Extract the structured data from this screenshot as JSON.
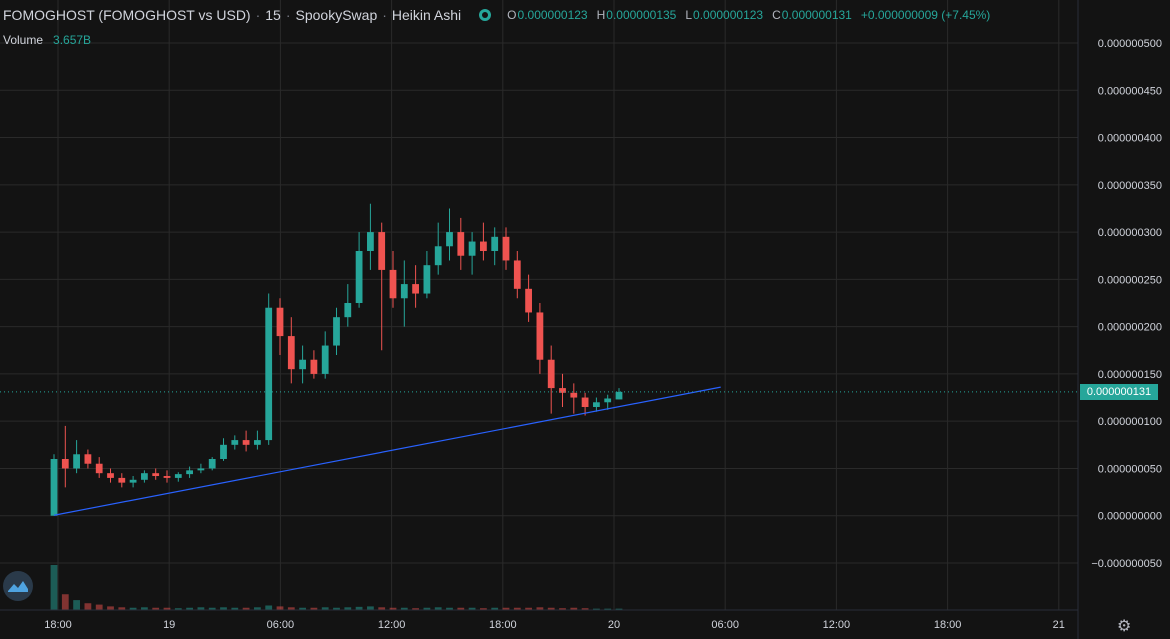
{
  "header": {
    "symbol": "FOMOGHOST (FOMOGHOST vs USD)",
    "interval": "15",
    "exchange": "SpookySwap",
    "chart_style": "Heikin Ashi",
    "ohlc": {
      "o_label": "O",
      "o": "0.000000123",
      "h_label": "H",
      "h": "0.000000135",
      "l_label": "L",
      "l": "0.000000123",
      "c_label": "C",
      "c": "0.000000131",
      "change": "+0.000000009 (+7.45%)"
    }
  },
  "volume": {
    "label": "Volume",
    "value": "3.657B"
  },
  "current_price_label": "0.000000131",
  "colors": {
    "up": "#26a69a",
    "down": "#ef5350",
    "trendline": "#2962ff",
    "grid": "#2a2a2a",
    "text": "#d1d4dc"
  },
  "icons": {
    "settings": "gear-icon",
    "logo": "tradingview-logo-icon",
    "visibility": "eye-icon"
  },
  "chart_data": {
    "type": "candlestick",
    "title": "FOMOGHOST (FOMOGHOST vs USD) · 15 · SpookySwap · Heikin Ashi",
    "xlabel": "",
    "ylabel": "",
    "x_ticks": [
      "18:00",
      "19",
      "06:00",
      "12:00",
      "18:00",
      "20",
      "06:00",
      "12:00",
      "18:00",
      "21"
    ],
    "y_ticks": [
      "0.000000500",
      "0.000000450",
      "0.000000400",
      "0.000000350",
      "0.000000300",
      "0.000000250",
      "0.000000200",
      "0.000000150",
      "0.000000100",
      "0.000000050",
      "0.000000000",
      "−0.000000050"
    ],
    "ylim": [
      -6e-08,
      5.15e-07
    ],
    "grid": true,
    "trendline": {
      "from": [
        0,
        5e-10
      ],
      "to": [
        59,
        1.36e-07
      ]
    },
    "current_price": 1.31e-07,
    "candles": [
      {
        "o": 0.0,
        "h": 6.5e-08,
        "l": 0.0,
        "c": 6e-08
      },
      {
        "o": 6e-08,
        "h": 9.5e-08,
        "l": 3e-08,
        "c": 5e-08
      },
      {
        "o": 5e-08,
        "h": 8e-08,
        "l": 4.5e-08,
        "c": 6.5e-08
      },
      {
        "o": 6.5e-08,
        "h": 7e-08,
        "l": 5e-08,
        "c": 5.5e-08
      },
      {
        "o": 5.5e-08,
        "h": 6.2e-08,
        "l": 4e-08,
        "c": 4.5e-08
      },
      {
        "o": 4.5e-08,
        "h": 5e-08,
        "l": 3.5e-08,
        "c": 4e-08
      },
      {
        "o": 4e-08,
        "h": 4.5e-08,
        "l": 3e-08,
        "c": 3.5e-08
      },
      {
        "o": 3.5e-08,
        "h": 4.2e-08,
        "l": 3e-08,
        "c": 3.8e-08
      },
      {
        "o": 3.8e-08,
        "h": 4.8e-08,
        "l": 3.5e-08,
        "c": 4.5e-08
      },
      {
        "o": 4.5e-08,
        "h": 5e-08,
        "l": 3.8e-08,
        "c": 4.2e-08
      },
      {
        "o": 4.2e-08,
        "h": 4.8e-08,
        "l": 3.5e-08,
        "c": 4e-08
      },
      {
        "o": 4e-08,
        "h": 4.6e-08,
        "l": 3.6e-08,
        "c": 4.4e-08
      },
      {
        "o": 4.4e-08,
        "h": 5.2e-08,
        "l": 4e-08,
        "c": 4.8e-08
      },
      {
        "o": 4.8e-08,
        "h": 5.5e-08,
        "l": 4.5e-08,
        "c": 5e-08
      },
      {
        "o": 5e-08,
        "h": 6.2e-08,
        "l": 4.8e-08,
        "c": 6e-08
      },
      {
        "o": 6e-08,
        "h": 8.2e-08,
        "l": 5.8e-08,
        "c": 7.5e-08
      },
      {
        "o": 7.5e-08,
        "h": 8.5e-08,
        "l": 7e-08,
        "c": 8e-08
      },
      {
        "o": 8e-08,
        "h": 9e-08,
        "l": 6.8e-08,
        "c": 7.5e-08
      },
      {
        "o": 7.5e-08,
        "h": 9e-08,
        "l": 7e-08,
        "c": 8e-08
      },
      {
        "o": 8e-08,
        "h": 2.35e-07,
        "l": 7.5e-08,
        "c": 2.2e-07
      },
      {
        "o": 2.2e-07,
        "h": 2.3e-07,
        "l": 1.7e-07,
        "c": 1.9e-07
      },
      {
        "o": 1.9e-07,
        "h": 2.1e-07,
        "l": 1.4e-07,
        "c": 1.55e-07
      },
      {
        "o": 1.55e-07,
        "h": 1.8e-07,
        "l": 1.4e-07,
        "c": 1.65e-07
      },
      {
        "o": 1.65e-07,
        "h": 1.75e-07,
        "l": 1.45e-07,
        "c": 1.5e-07
      },
      {
        "o": 1.5e-07,
        "h": 1.95e-07,
        "l": 1.45e-07,
        "c": 1.8e-07
      },
      {
        "o": 1.8e-07,
        "h": 2.2e-07,
        "l": 1.7e-07,
        "c": 2.1e-07
      },
      {
        "o": 2.1e-07,
        "h": 2.45e-07,
        "l": 2e-07,
        "c": 2.25e-07
      },
      {
        "o": 2.25e-07,
        "h": 3e-07,
        "l": 2.2e-07,
        "c": 2.8e-07
      },
      {
        "o": 2.8e-07,
        "h": 3.3e-07,
        "l": 2.6e-07,
        "c": 3e-07
      },
      {
        "o": 3e-07,
        "h": 3.1e-07,
        "l": 1.75e-07,
        "c": 2.6e-07
      },
      {
        "o": 2.6e-07,
        "h": 2.8e-07,
        "l": 2.2e-07,
        "c": 2.3e-07
      },
      {
        "o": 2.3e-07,
        "h": 2.7e-07,
        "l": 2e-07,
        "c": 2.45e-07
      },
      {
        "o": 2.45e-07,
        "h": 2.65e-07,
        "l": 2.2e-07,
        "c": 2.35e-07
      },
      {
        "o": 2.35e-07,
        "h": 2.8e-07,
        "l": 2.3e-07,
        "c": 2.65e-07
      },
      {
        "o": 2.65e-07,
        "h": 3.1e-07,
        "l": 2.55e-07,
        "c": 2.85e-07
      },
      {
        "o": 2.85e-07,
        "h": 3.25e-07,
        "l": 2.7e-07,
        "c": 3e-07
      },
      {
        "o": 3e-07,
        "h": 3.15e-07,
        "l": 2.6e-07,
        "c": 2.75e-07
      },
      {
        "o": 2.75e-07,
        "h": 3e-07,
        "l": 2.55e-07,
        "c": 2.9e-07
      },
      {
        "o": 2.9e-07,
        "h": 3.1e-07,
        "l": 2.7e-07,
        "c": 2.8e-07
      },
      {
        "o": 2.8e-07,
        "h": 3.05e-07,
        "l": 2.65e-07,
        "c": 2.95e-07
      },
      {
        "o": 2.95e-07,
        "h": 3.05e-07,
        "l": 2.6e-07,
        "c": 2.7e-07
      },
      {
        "o": 2.7e-07,
        "h": 2.8e-07,
        "l": 2.3e-07,
        "c": 2.4e-07
      },
      {
        "o": 2.4e-07,
        "h": 2.55e-07,
        "l": 2.05e-07,
        "c": 2.15e-07
      },
      {
        "o": 2.15e-07,
        "h": 2.25e-07,
        "l": 1.5e-07,
        "c": 1.65e-07
      },
      {
        "o": 1.65e-07,
        "h": 1.8e-07,
        "l": 1.08e-07,
        "c": 1.35e-07
      },
      {
        "o": 1.35e-07,
        "h": 1.5e-07,
        "l": 1.15e-07,
        "c": 1.3e-07
      },
      {
        "o": 1.3e-07,
        "h": 1.4e-07,
        "l": 1.08e-07,
        "c": 1.25e-07
      },
      {
        "o": 1.25e-07,
        "h": 1.3e-07,
        "l": 1.06e-07,
        "c": 1.15e-07
      },
      {
        "o": 1.15e-07,
        "h": 1.25e-07,
        "l": 1.1e-07,
        "c": 1.2e-07
      },
      {
        "o": 1.2e-07,
        "h": 1.28e-07,
        "l": 1.12e-07,
        "c": 1.24e-07
      },
      {
        "o": 1.23e-07,
        "h": 1.35e-07,
        "l": 1.23e-07,
        "c": 1.31e-07
      }
    ],
    "volumes": [
      1.0,
      0.35,
      0.22,
      0.15,
      0.12,
      0.08,
      0.06,
      0.05,
      0.06,
      0.05,
      0.05,
      0.04,
      0.05,
      0.06,
      0.05,
      0.06,
      0.05,
      0.05,
      0.06,
      0.1,
      0.08,
      0.06,
      0.05,
      0.05,
      0.06,
      0.05,
      0.06,
      0.07,
      0.08,
      0.06,
      0.05,
      0.05,
      0.04,
      0.05,
      0.06,
      0.05,
      0.05,
      0.05,
      0.04,
      0.05,
      0.05,
      0.05,
      0.05,
      0.06,
      0.05,
      0.04,
      0.05,
      0.04,
      0.03,
      0.03,
      0.03
    ]
  }
}
